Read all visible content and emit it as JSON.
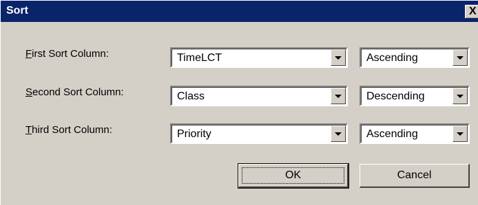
{
  "window": {
    "title": "Sort",
    "close_glyph": "X"
  },
  "rows": [
    {
      "label_prefix": "",
      "label_accel": "F",
      "label_rest": "irst Sort Column:",
      "column": "TimeLCT",
      "order": "Ascending"
    },
    {
      "label_prefix": "",
      "label_accel": "S",
      "label_rest": "econd Sort Column:",
      "column": "Class",
      "order": "Descending"
    },
    {
      "label_prefix": "",
      "label_accel": "T",
      "label_rest": "hird Sort Column:",
      "column": "Priority",
      "order": "Ascending"
    }
  ],
  "buttons": {
    "ok_label": "OK",
    "cancel_label": "Cancel"
  },
  "colors": {
    "titlebar": "#0a246a",
    "face": "#d4d0c8"
  }
}
